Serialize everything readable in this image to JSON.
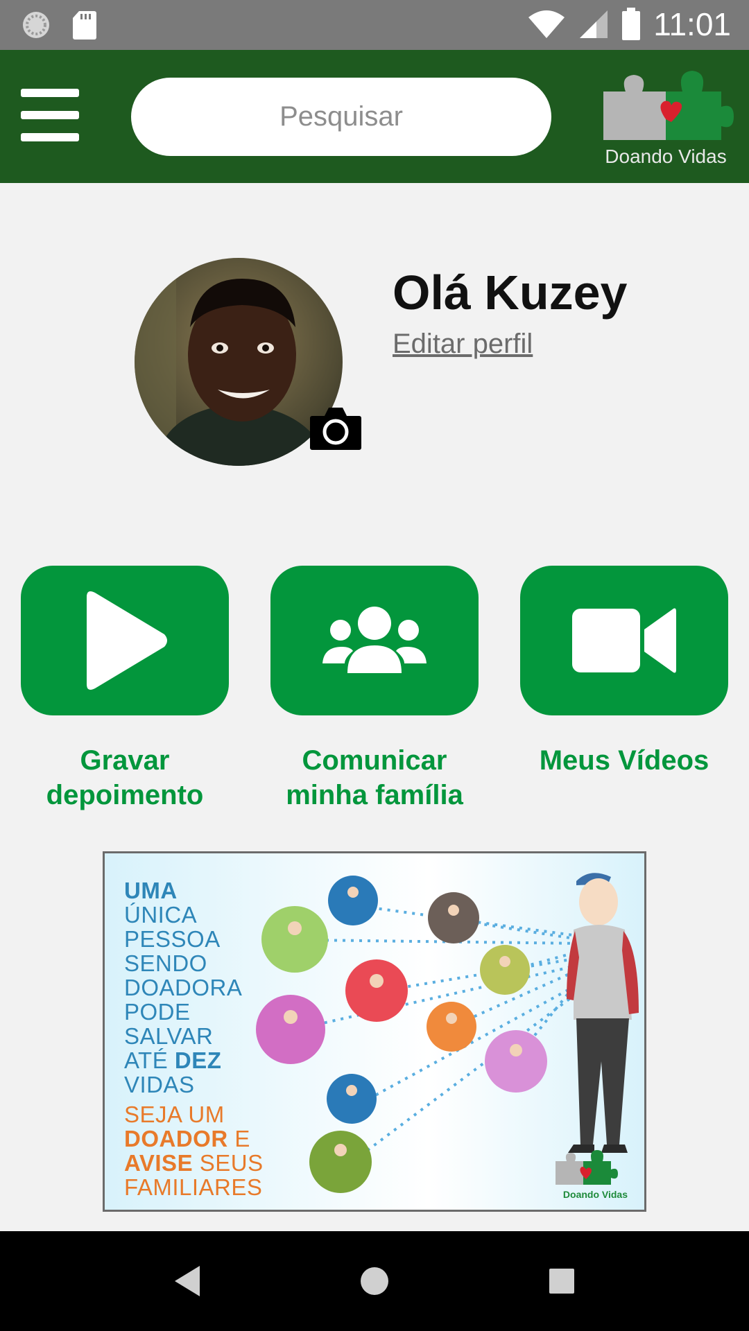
{
  "status_bar": {
    "time": "11:01"
  },
  "app_bar": {
    "search_placeholder": "Pesquisar",
    "logo_text": "Doando Vidas"
  },
  "profile": {
    "greeting": "Olá Kuzey",
    "edit_label": "Editar perfil"
  },
  "actions": [
    {
      "label_line1": "Gravar",
      "label_line2": "depoimento"
    },
    {
      "label_line1": "Comunicar",
      "label_line2": "minha família"
    },
    {
      "label_line1": "Meus Vídeos",
      "label_line2": ""
    }
  ],
  "banner": {
    "lines_blue": [
      "UMA",
      "ÚNICA",
      "PESSOA",
      "SENDO",
      "DOADORA",
      "PODE",
      "SALVAR"
    ],
    "line_ate": "ATÉ",
    "line_dez": "DEZ",
    "line_vidas": "VIDAS",
    "line_seja": "SEJA UM",
    "line_doador": "DOADOR",
    "line_e": "E",
    "line_avise": "AVISE",
    "line_seus": "SEUS",
    "line_familiares": "FAMILIARES",
    "logo_text": "Doando Vidas"
  },
  "colors": {
    "app_bar": "#1e5a1f",
    "accent_green": "#03963c",
    "status_bar": "#7a7a7a"
  }
}
